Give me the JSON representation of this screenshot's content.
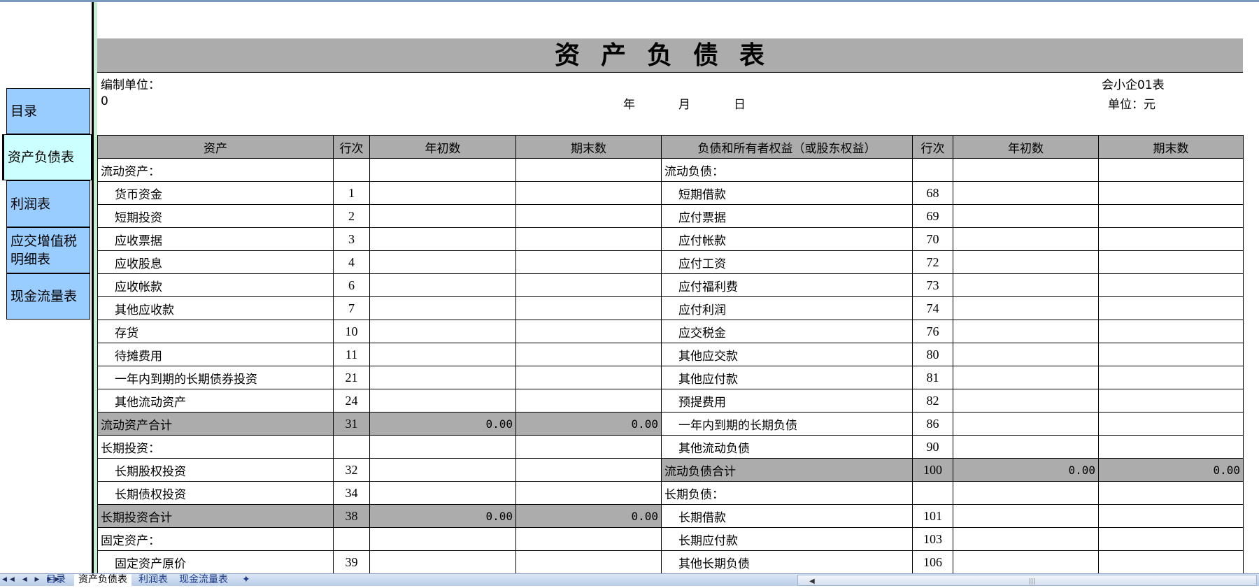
{
  "sidebar": {
    "items": [
      {
        "label": "目录",
        "active": false
      },
      {
        "label": "资产负债表",
        "active": true
      },
      {
        "label": "利润表",
        "active": false
      },
      {
        "label": "应交增值税明细表",
        "active": false
      },
      {
        "label": "现金流量表",
        "active": false
      }
    ]
  },
  "sheet": {
    "title": "资产负债表",
    "unit_label": "编制单位：",
    "unit_value": "0",
    "year": "年",
    "month": "月",
    "day": "日",
    "form_code": "会小企01表",
    "currency": "单位：元"
  },
  "table": {
    "headers": [
      "资产",
      "行次",
      "年初数",
      "期末数",
      "负债和所有者权益（或股东权益）",
      "行次",
      "年初数",
      "期末数"
    ],
    "left": [
      {
        "name": "流动资产：",
        "line": "",
        "begin": "",
        "end": "",
        "type": "section"
      },
      {
        "name": "货币资金",
        "line": "1",
        "begin": "",
        "end": "",
        "type": "item"
      },
      {
        "name": "短期投资",
        "line": "2",
        "begin": "",
        "end": "",
        "type": "item"
      },
      {
        "name": "应收票据",
        "line": "3",
        "begin": "",
        "end": "",
        "type": "item"
      },
      {
        "name": "应收股息",
        "line": "4",
        "begin": "",
        "end": "",
        "type": "item"
      },
      {
        "name": "应收帐款",
        "line": "6",
        "begin": "",
        "end": "",
        "type": "item"
      },
      {
        "name": "其他应收款",
        "line": "7",
        "begin": "",
        "end": "",
        "type": "item"
      },
      {
        "name": "存货",
        "line": "10",
        "begin": "",
        "end": "",
        "type": "item"
      },
      {
        "name": "待摊费用",
        "line": "11",
        "begin": "",
        "end": "",
        "type": "item"
      },
      {
        "name": "一年内到期的长期债券投资",
        "line": "21",
        "begin": "",
        "end": "",
        "type": "item"
      },
      {
        "name": "其他流动资产",
        "line": "24",
        "begin": "",
        "end": "",
        "type": "item"
      },
      {
        "name": "流动资产合计",
        "line": "31",
        "begin": "0.00",
        "end": "0.00",
        "type": "total"
      },
      {
        "name": "长期投资：",
        "line": "",
        "begin": "",
        "end": "",
        "type": "section"
      },
      {
        "name": "长期股权投资",
        "line": "32",
        "begin": "",
        "end": "",
        "type": "item"
      },
      {
        "name": "长期债权投资",
        "line": "34",
        "begin": "",
        "end": "",
        "type": "item"
      },
      {
        "name": "长期投资合计",
        "line": "38",
        "begin": "0.00",
        "end": "0.00",
        "type": "total"
      },
      {
        "name": "固定资产：",
        "line": "",
        "begin": "",
        "end": "",
        "type": "section"
      },
      {
        "name": "固定资产原价",
        "line": "39",
        "begin": "",
        "end": "",
        "type": "item"
      }
    ],
    "right": [
      {
        "name": "流动负债：",
        "line": "",
        "begin": "",
        "end": "",
        "type": "section"
      },
      {
        "name": "短期借款",
        "line": "68",
        "begin": "",
        "end": "",
        "type": "item"
      },
      {
        "name": "应付票据",
        "line": "69",
        "begin": "",
        "end": "",
        "type": "item"
      },
      {
        "name": "应付帐款",
        "line": "70",
        "begin": "",
        "end": "",
        "type": "item"
      },
      {
        "name": "应付工资",
        "line": "72",
        "begin": "",
        "end": "",
        "type": "item"
      },
      {
        "name": "应付福利费",
        "line": "73",
        "begin": "",
        "end": "",
        "type": "item"
      },
      {
        "name": "应付利润",
        "line": "74",
        "begin": "",
        "end": "",
        "type": "item"
      },
      {
        "name": "应交税金",
        "line": "76",
        "begin": "",
        "end": "",
        "type": "item"
      },
      {
        "name": "其他应交款",
        "line": "80",
        "begin": "",
        "end": "",
        "type": "item"
      },
      {
        "name": "其他应付款",
        "line": "81",
        "begin": "",
        "end": "",
        "type": "item"
      },
      {
        "name": "预提费用",
        "line": "82",
        "begin": "",
        "end": "",
        "type": "item"
      },
      {
        "name": "一年内到期的长期负债",
        "line": "86",
        "begin": "",
        "end": "",
        "type": "item"
      },
      {
        "name": "其他流动负债",
        "line": "90",
        "begin": "",
        "end": "",
        "type": "item"
      },
      {
        "name": "流动负债合计",
        "line": "100",
        "begin": "0.00",
        "end": "0.00",
        "type": "total"
      },
      {
        "name": "长期负债：",
        "line": "",
        "begin": "",
        "end": "",
        "type": "section"
      },
      {
        "name": "长期借款",
        "line": "101",
        "begin": "",
        "end": "",
        "type": "item"
      },
      {
        "name": "长期应付款",
        "line": "103",
        "begin": "",
        "end": "",
        "type": "item"
      },
      {
        "name": "其他长期负债",
        "line": "106",
        "begin": "",
        "end": "",
        "type": "item"
      }
    ]
  },
  "tabs": {
    "items": [
      "目录",
      "资产负债表",
      "利润表",
      "现金流量表"
    ],
    "active": 1
  },
  "colors": {
    "sidebar": "#99ccff",
    "sidebar_active": "#ccffff",
    "header_gray": "#acacac"
  }
}
